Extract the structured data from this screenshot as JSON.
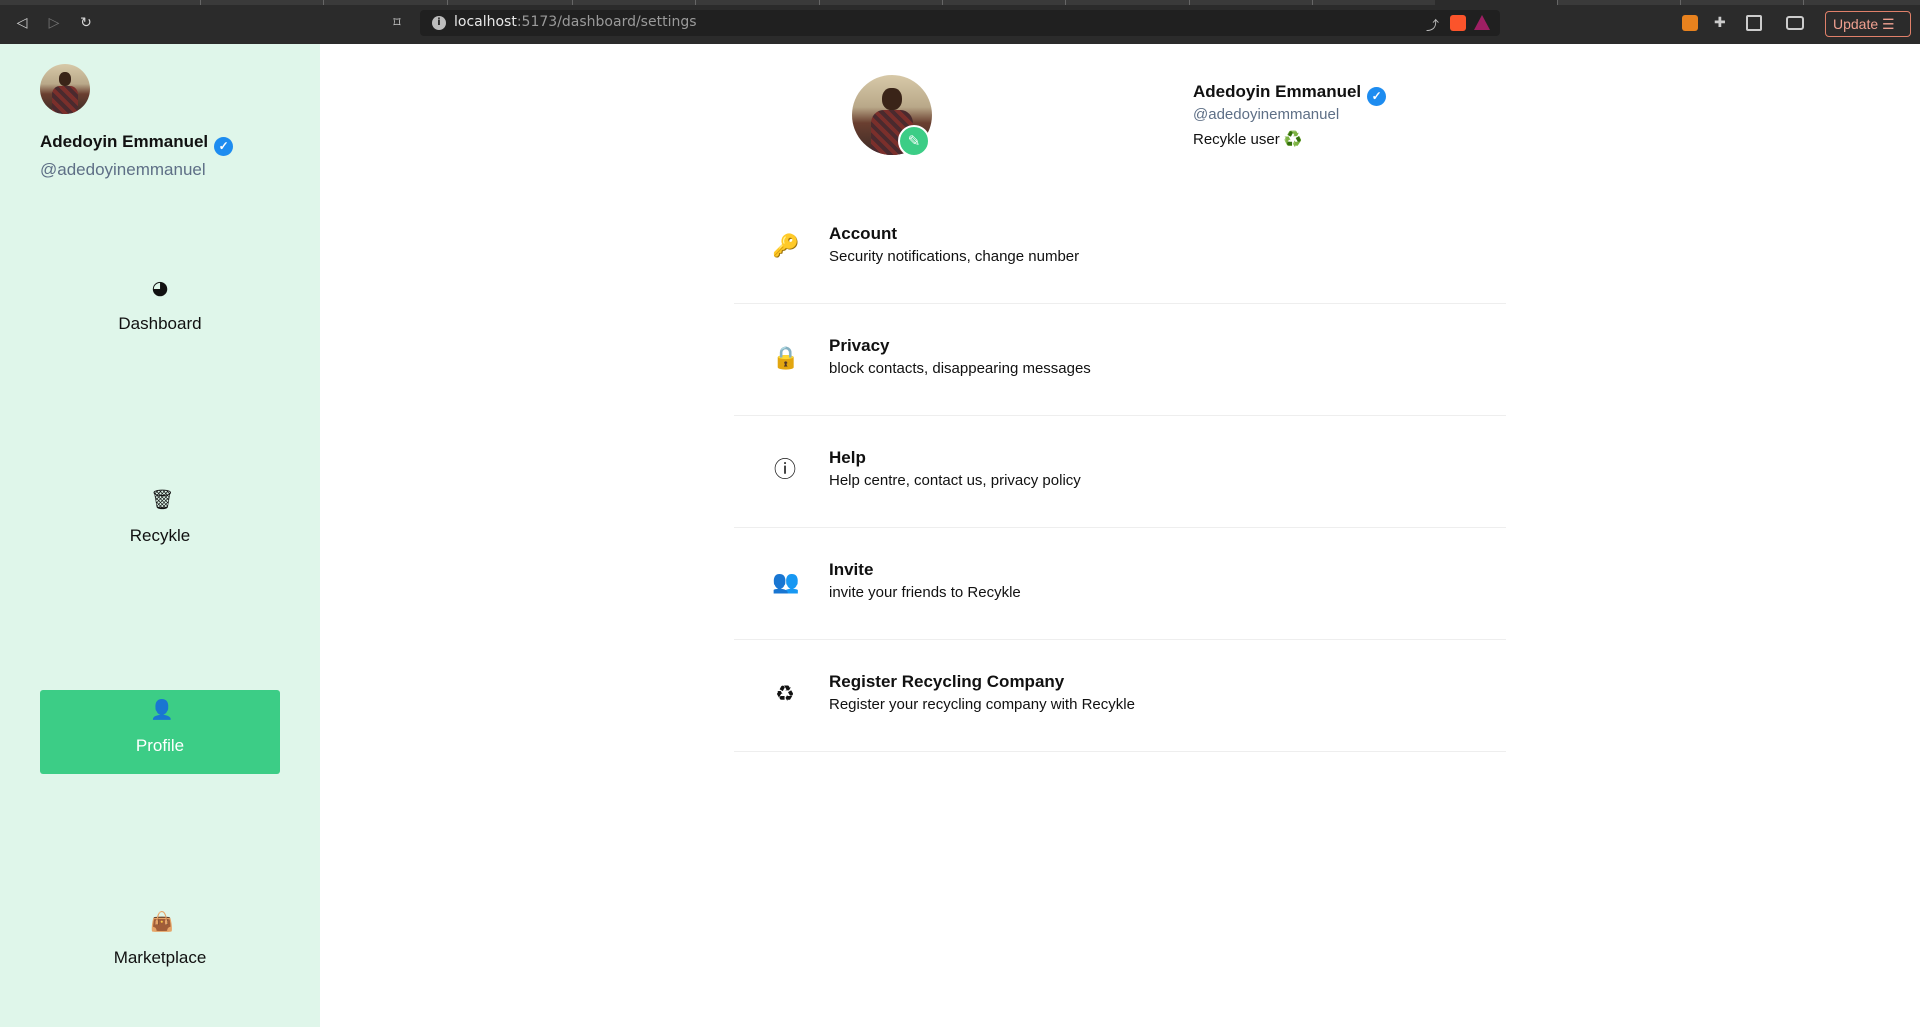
{
  "browser": {
    "url_host": "localhost",
    "url_path": ":5173/dashboard/settings",
    "update_label": "Update"
  },
  "user": {
    "name": "Adedoyin Emmanuel",
    "handle": "@adedoyinemmanuel",
    "bio": "Recykle user",
    "bio_icon": "♻️"
  },
  "sidebar": {
    "items": [
      {
        "label": "Dashboard",
        "icon": "dashboard-gauge-icon"
      },
      {
        "label": "Recykle",
        "icon": "trash-icon"
      },
      {
        "label": "Profile",
        "icon": "user-icon",
        "active": true
      },
      {
        "label": "Marketplace",
        "icon": "shopping-bag-icon"
      }
    ]
  },
  "settings": [
    {
      "title": "Account",
      "subtitle": "Security notifications, change number",
      "icon": "key-icon"
    },
    {
      "title": "Privacy",
      "subtitle": "block contacts, disappearing messages",
      "icon": "lock-icon"
    },
    {
      "title": "Help",
      "subtitle": "Help centre, contact us, privacy policy",
      "icon": "help-circle-icon"
    },
    {
      "title": "Invite",
      "subtitle": "invite your friends to Recykle",
      "icon": "users-icon"
    },
    {
      "title": "Register Recycling Company",
      "subtitle": "Register your recycling company with Recykle",
      "icon": "recycle-icon"
    }
  ],
  "colors": {
    "sidebar_bg": "#dff6ea",
    "accent": "#3ccd86",
    "verified": "#1d8cf0",
    "handle": "#5e6f86"
  }
}
